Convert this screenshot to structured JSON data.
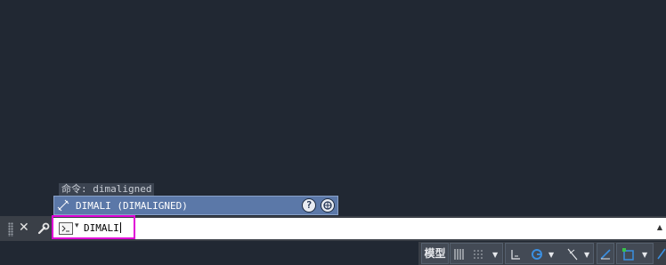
{
  "command_history": {
    "last_line": "命令:  dimaligned"
  },
  "autocomplete": {
    "suggestion": "DIMALI (DIMALIGNED)",
    "help_icon": "question-icon",
    "web_icon": "globe-search-icon"
  },
  "command_line": {
    "input_value": "DIMALI",
    "prompt_icon": "command-prompt-icon",
    "close_icon": "close-icon",
    "customize_icon": "wrench-icon",
    "scroll_icon": "scroll-up-icon"
  },
  "status_bar": {
    "model_label": "模型",
    "icons": [
      "grid-icon",
      "snap-icon",
      "ortho-icon",
      "polar-tracking-icon",
      "isodraft-icon",
      "dynamic-ucs-icon",
      "osnap-icon"
    ]
  },
  "colors": {
    "canvas": "#212833",
    "highlight": "#e000d6",
    "suggestion_bg": "#5b78a8",
    "accent_blue": "#3b8fe0"
  }
}
